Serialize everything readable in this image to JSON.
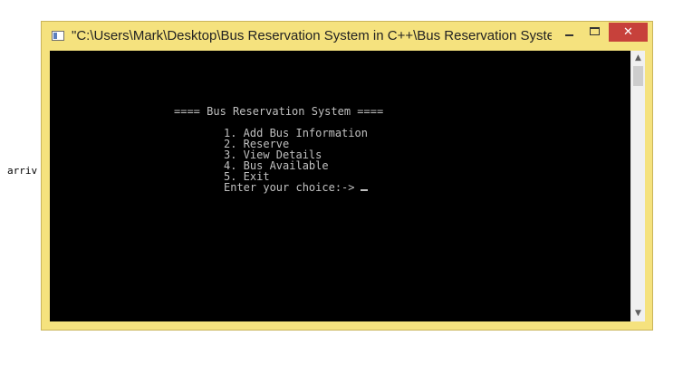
{
  "background": {
    "partial_text": "arriv"
  },
  "window": {
    "title": "\"C:\\Users\\Mark\\Desktop\\Bus Reservation System in C++\\Bus Reservation Syste...",
    "buttons": {
      "minimize_icon": "minimize-icon",
      "maximize_icon": "maximize-icon",
      "close_label": "✕"
    }
  },
  "console": {
    "header": "==== Bus Reservation System ====",
    "menu": [
      "1. Add Bus Information",
      "2. Reserve",
      "3. View Details",
      "4. Bus Available",
      "5. Exit"
    ],
    "prompt": "Enter your choice:->"
  },
  "scrollbar": {
    "up_arrow": "▲",
    "down_arrow": "▼"
  },
  "colors": {
    "window_frame": "#f5e27e",
    "console_bg": "#000000",
    "console_fg": "#c0c0c0",
    "close_button": "#c7413b"
  }
}
